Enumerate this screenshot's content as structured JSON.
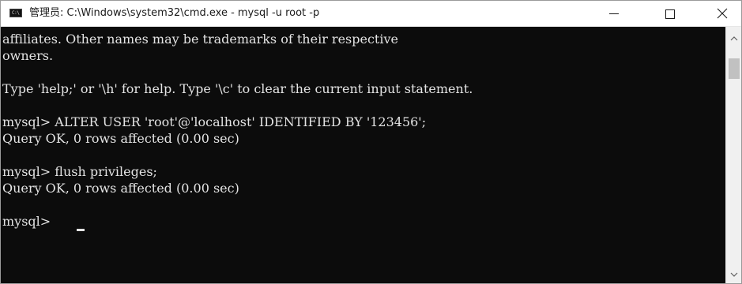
{
  "window": {
    "title": "管理员: C:\\Windows\\system32\\cmd.exe - mysql  -u root -p",
    "icon": "cmd-icon",
    "icon_label": "C:\\"
  },
  "buttons": {
    "minimize": "minimize-icon",
    "maximize": "maximize-icon",
    "close": "close-icon"
  },
  "console": {
    "lines": [
      "affiliates. Other names may be trademarks of their respective",
      "owners.",
      "",
      "Type 'help;' or '\\h' for help. Type '\\c' to clear the current input statement.",
      "",
      "mysql> ALTER USER 'root'@'localhost' IDENTIFIED BY '123456';",
      "Query OK, 0 rows affected (0.00 sec)",
      "",
      "mysql> flush privileges;",
      "Query OK, 0 rows affected (0.00 sec)",
      "",
      "mysql> "
    ]
  },
  "colors": {
    "console_bg": "#0c0c0c",
    "console_fg": "#e4e4e4",
    "titlebar_bg": "#ffffff"
  }
}
